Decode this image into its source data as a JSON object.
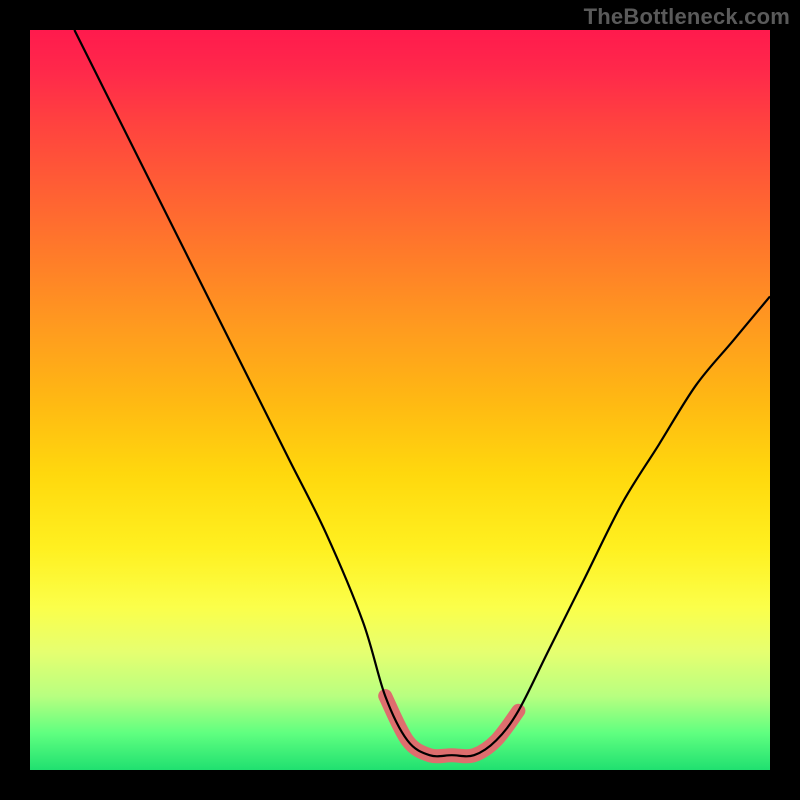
{
  "watermark": "TheBottleneck.com",
  "chart_data": {
    "type": "line",
    "title": "",
    "xlabel": "",
    "ylabel": "",
    "xlim": [
      0,
      100
    ],
    "ylim": [
      0,
      100
    ],
    "series": [
      {
        "name": "bottleneck-curve",
        "x": [
          6,
          10,
          15,
          20,
          25,
          30,
          35,
          40,
          45,
          48,
          51,
          54,
          57,
          60,
          63,
          66,
          70,
          75,
          80,
          85,
          90,
          95,
          100
        ],
        "y": [
          100,
          92,
          82,
          72,
          62,
          52,
          42,
          32,
          20,
          10,
          4,
          2,
          2,
          2,
          4,
          8,
          16,
          26,
          36,
          44,
          52,
          58,
          64
        ]
      },
      {
        "name": "optimal-range-highlight",
        "x": [
          48,
          51,
          54,
          57,
          60,
          63,
          66
        ],
        "y": [
          10,
          4,
          2,
          2,
          2,
          4,
          8
        ]
      }
    ],
    "background_gradient": {
      "top_color": "#ff1a4d",
      "mid_color": "#ffd80d",
      "bottom_color": "#20e070"
    }
  }
}
